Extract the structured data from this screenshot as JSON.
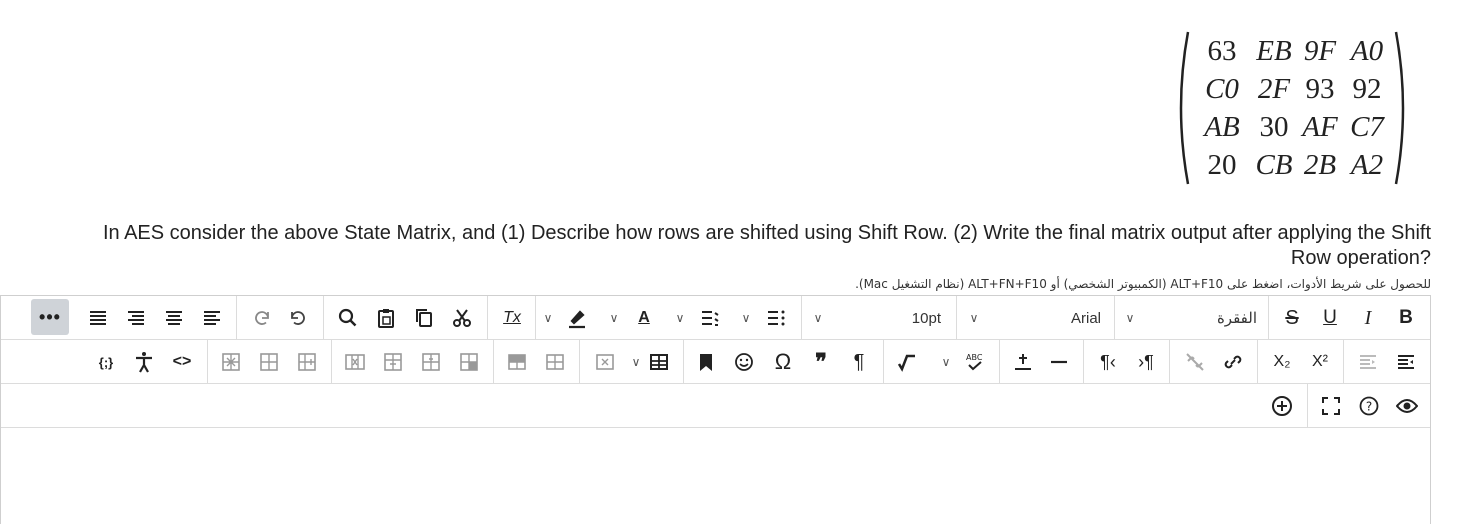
{
  "matrix": {
    "rows": [
      [
        "63",
        "EB",
        "9F",
        "A0"
      ],
      [
        "C0",
        "2F",
        "93",
        "92"
      ],
      [
        "AB",
        "30",
        "AF",
        "C7"
      ],
      [
        "20",
        "CB",
        "2B",
        "A2"
      ]
    ]
  },
  "question": {
    "line1": "In AES consider the above State Matrix, and (1)  Describe how rows are shifted using Shift Row. (2) Write the final matrix output after applying the Shift",
    "line2": "Row operation?"
  },
  "accessibility_note": "للحصول على شريط الأدوات، اضغط على ALT+F10 (الكمبيوتر الشخصي) أو ALT+FN+F10 (نظام التشغيل Mac).",
  "toolbar": {
    "more": "•••",
    "font_size": "10pt",
    "font_family": "Arial",
    "paragraph_style": "الفقرة",
    "bold": "B",
    "italic": "I",
    "underline": "U",
    "strikethrough": "S",
    "clear_format": "Tx",
    "text_color": "A",
    "blockquote": "❞",
    "omega": "Ω",
    "pilcrow": "¶",
    "subscript": "X₂",
    "superscript": "X²",
    "source_code": "<>",
    "mathtype": "{;}"
  },
  "colors": {
    "border": "#cfcfcf",
    "more_bg": "#cfd3d8",
    "text": "#222222"
  },
  "icons": [
    "align-justify-icon",
    "align-right-icon",
    "align-center-icon",
    "align-left-icon",
    "redo-icon",
    "undo-icon",
    "search-icon",
    "paste-icon",
    "copy-icon",
    "cut-icon",
    "highlight-icon",
    "bullet-list-icon",
    "numbered-list-icon",
    "add-icon",
    "fullscreen-icon",
    "help-icon",
    "preview-icon"
  ]
}
